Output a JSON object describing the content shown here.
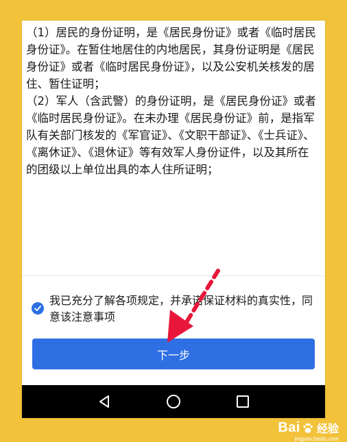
{
  "content": {
    "paragraphs": [
      "（1）居民的身份证明，是《居民身份证》或者《临时居民身份证》。在暂住地居住的内地居民，其身份证明是《居民身份证》或者《临时居民身份证》，以及公安机关核发的居住、暂住证明；",
      "（2）军人（含武警）的身份证明，是《居民身份证》或者《临时居民身份证》。在未办理《居民身份证》前，是指军队有关部门核发的《军官证》、《文职干部证》、《士兵证》、《离休证》、《退休证》等有效军人身份证件，以及其所在的团级以上单位出具的本人住所证明；"
    ]
  },
  "agreement": {
    "text": "我已充分了解各项规定，并承诺保证材料的真实性，同意该注意事项",
    "checked": true
  },
  "next_button": {
    "label": "下一步"
  },
  "nav_bar": {
    "icons": [
      "back-triangle-icon",
      "home-circle-icon",
      "recents-square-icon"
    ]
  },
  "watermark": {
    "brand": "Bai",
    "brand_cn": "经验",
    "site": "jingyan.baidu.com"
  },
  "colors": {
    "accent": "#2f6fe4",
    "background": "#f2c23a",
    "annotation": "#e8173a"
  }
}
